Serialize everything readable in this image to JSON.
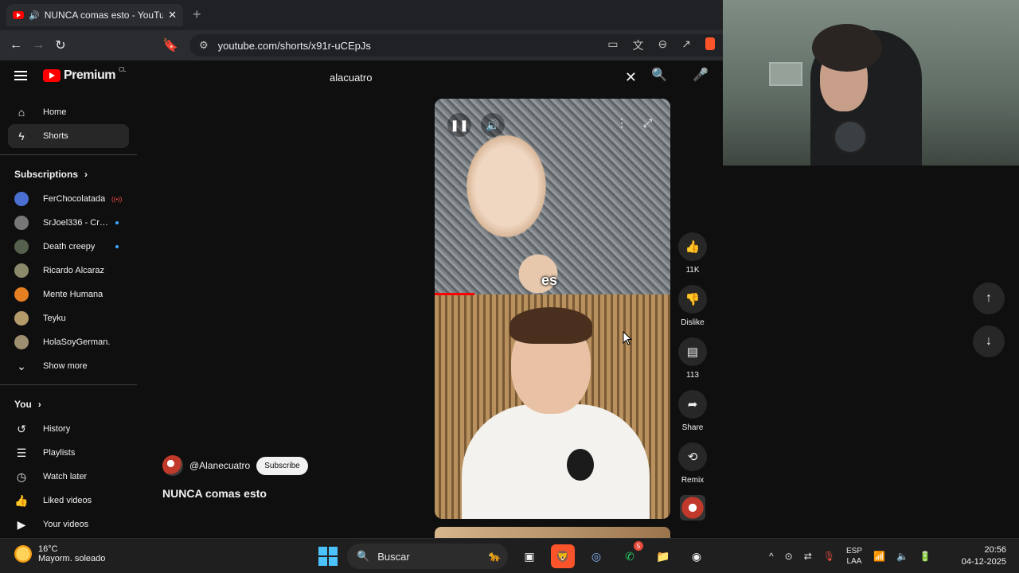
{
  "browser": {
    "tab_title": "NUNCA comas esto - YouTube",
    "tab_close": "✕",
    "new_tab": "+",
    "url": "youtube.com/shorts/x91r-uCEpJs"
  },
  "masthead": {
    "logo_text": "Premium",
    "logo_region": "CL",
    "search_value": "alacuatro"
  },
  "sidebar": {
    "home": "Home",
    "shorts": "Shorts",
    "subscriptions_header": "Subscriptions",
    "subscriptions": [
      {
        "name": "FerChocolatada",
        "color": "#4a6fd1",
        "indicator": "live"
      },
      {
        "name": "SrJoel336 - Cree...",
        "color": "#777777",
        "indicator": "dot"
      },
      {
        "name": "Death creepy",
        "color": "#56614d",
        "indicator": "dot"
      },
      {
        "name": "Ricardo Alcaraz",
        "color": "#8b8b6b",
        "indicator": ""
      },
      {
        "name": "Mente Humana",
        "color": "#e67e22",
        "indicator": ""
      },
      {
        "name": "Teyku",
        "color": "#b59a6b",
        "indicator": ""
      },
      {
        "name": "HolaSoyGerman.",
        "color": "#9d8f70",
        "indicator": ""
      }
    ],
    "live_glyph": "((•))",
    "show_more": "Show more",
    "you_header": "You",
    "you_items": [
      {
        "label": "History",
        "icon": "history-icon",
        "glyph": "↺"
      },
      {
        "label": "Playlists",
        "icon": "playlists-icon",
        "glyph": "☰"
      },
      {
        "label": "Watch later",
        "icon": "clock-icon",
        "glyph": "◷"
      },
      {
        "label": "Liked videos",
        "icon": "thumb-up-icon",
        "glyph": "👍"
      },
      {
        "label": "Your videos",
        "icon": "your-videos-icon",
        "glyph": "▶"
      }
    ]
  },
  "short": {
    "channel": "@Alanecuatro",
    "subscribe": "Subscribe",
    "title": "NUNCA comas esto",
    "caption_word": "es",
    "progress_fraction": 0.17
  },
  "actions": {
    "likes": "11K",
    "dislike": "Dislike",
    "comments": "113",
    "share": "Share",
    "remix": "Remix"
  },
  "taskbar": {
    "temperature": "16°C",
    "weather": "Mayorm. soleado",
    "search_placeholder": "Buscar",
    "lang_line1": "ESP",
    "lang_line2": "LAA",
    "time": "20:56",
    "date": "04-12-2025",
    "whatsapp_badge": "5"
  },
  "colors": {
    "background": "#0f0f0f",
    "youtube_red": "#ff0000",
    "accent_blue": "#3ea6ff"
  }
}
